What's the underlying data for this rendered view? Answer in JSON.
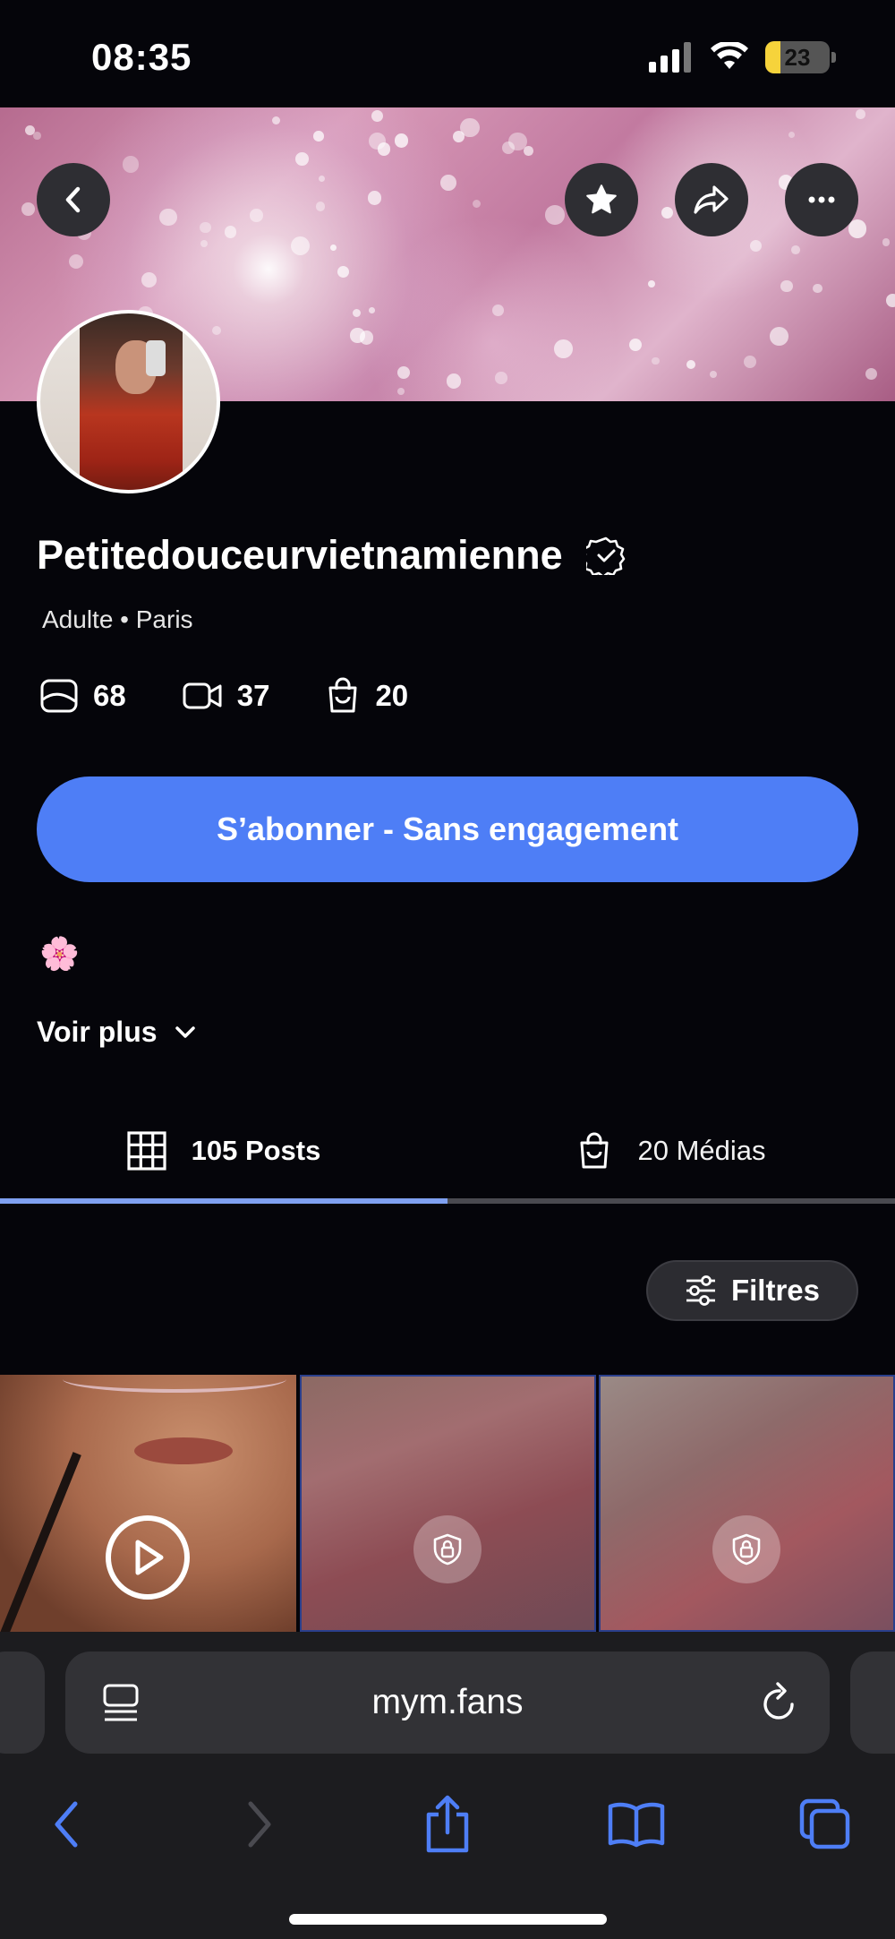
{
  "status_bar": {
    "time": "08:35",
    "battery": "23",
    "battery_level": 0.23
  },
  "profile": {
    "name": "Petitedouceurvietnamienne",
    "subtitle": "Adulte • Paris",
    "stats": [
      {
        "icon": "photo-icon",
        "value": "68"
      },
      {
        "icon": "video-icon",
        "value": "37"
      },
      {
        "icon": "bag-icon",
        "value": "20"
      }
    ],
    "subscribe_label": "S’abonner - Sans engagement",
    "bio_emoji": "🌸",
    "voir_plus_label": "Voir plus"
  },
  "tabs": [
    {
      "label": "105 Posts",
      "icon": "grid-icon",
      "active": true
    },
    {
      "label": "20 Médias",
      "icon": "bag-icon",
      "active": false
    }
  ],
  "filters_label": "Filtres",
  "posts": [
    {
      "type": "video",
      "icon": "play-icon",
      "locked": false
    },
    {
      "type": "photo",
      "icon": "lock-icon",
      "locked": true
    },
    {
      "type": "photo",
      "icon": "lock-icon",
      "locked": true
    }
  ],
  "browser": {
    "url": "mym.fans"
  },
  "colors": {
    "accent": "#4e7ef6",
    "tab_indicator": "#7fa0f0",
    "background": "#05050a"
  }
}
